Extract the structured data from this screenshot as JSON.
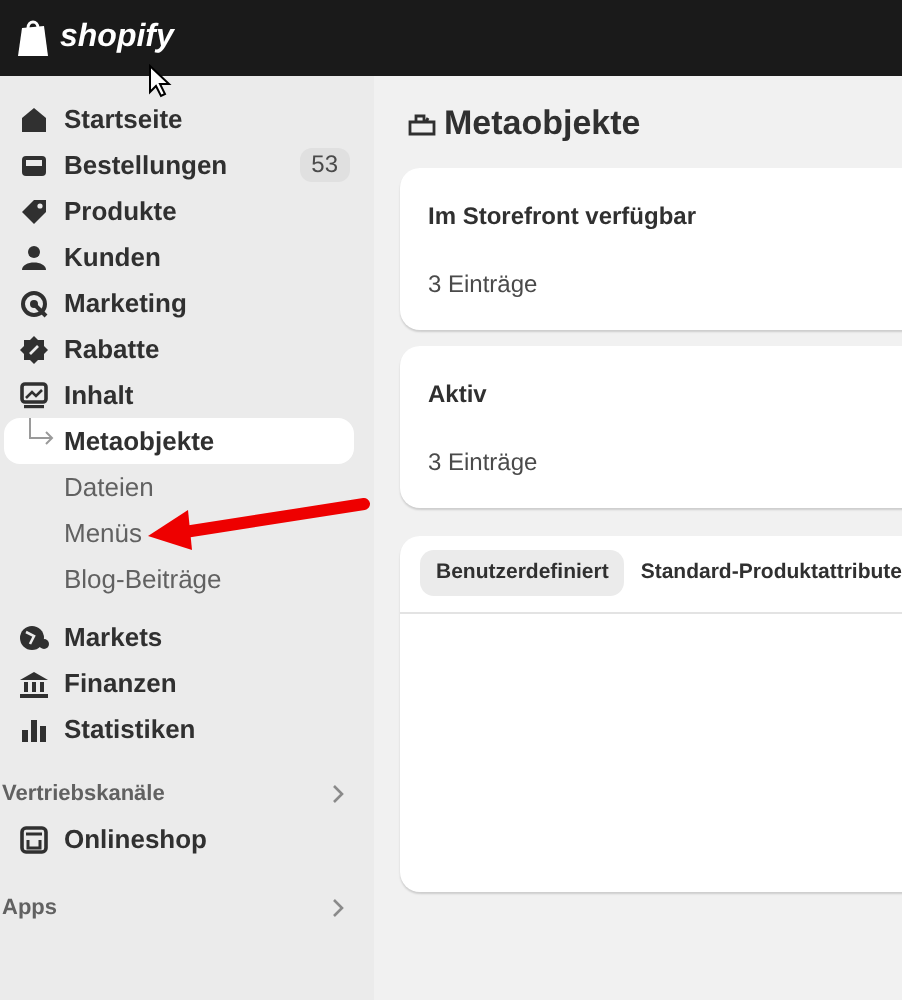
{
  "topbar": {
    "logo": "shopify"
  },
  "sidebar": {
    "items": [
      {
        "label": "Startseite",
        "selected": false
      },
      {
        "label": "Bestellungen",
        "selected": false,
        "badge": "53"
      },
      {
        "label": "Produkte",
        "selected": false
      },
      {
        "label": "Kunden",
        "selected": false
      },
      {
        "label": "Marketing",
        "selected": false
      },
      {
        "label": "Rabatte",
        "selected": false
      },
      {
        "label": "Inhalt",
        "selected": false,
        "children": [
          {
            "label": "Metaobjekte",
            "selected": true
          },
          {
            "label": "Dateien",
            "selected": false
          },
          {
            "label": "Menüs",
            "selected": false
          },
          {
            "label": "Blog-Beiträge",
            "selected": false
          }
        ]
      },
      {
        "label": "Markets",
        "selected": false
      },
      {
        "label": "Finanzen",
        "selected": false
      },
      {
        "label": "Statistiken",
        "selected": false
      }
    ],
    "sections": [
      {
        "title": "Vertriebskanäle",
        "items": [
          {
            "label": "Onlineshop",
            "selected": false
          }
        ]
      },
      {
        "title": "Apps"
      }
    ]
  },
  "page": {
    "title": "Metaobjekte",
    "cards": [
      {
        "title": "Im Storefront verfügbar",
        "count": "3 Einträge"
      },
      {
        "title": "Aktiv",
        "count": "3 Einträge"
      }
    ],
    "tabs": [
      {
        "label": "Benutzerdefiniert",
        "selected": true
      },
      {
        "label": "Standard-Produktattribute",
        "selected": false
      }
    ]
  }
}
